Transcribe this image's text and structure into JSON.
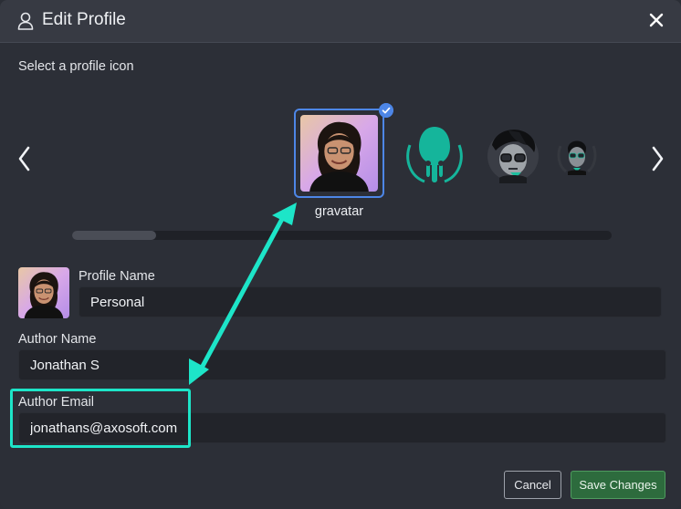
{
  "dialog": {
    "title": "Edit Profile",
    "title_icon": "user-icon",
    "close_icon": "close-icon"
  },
  "icon_picker": {
    "section_label": "Select a profile icon",
    "prev_icon": "chevron-left-icon",
    "next_icon": "chevron-right-icon",
    "selected_check_icon": "check-icon",
    "options": [
      {
        "name": "gravatar",
        "label": "gravatar",
        "selected": true
      },
      {
        "name": "gitkraken-logo",
        "selected": false
      },
      {
        "name": "keif-avatar",
        "selected": false
      },
      {
        "name": "keif-avatar-small",
        "selected": false
      }
    ],
    "scroll_position": 0.1
  },
  "form": {
    "profile_name": {
      "label": "Profile Name",
      "value": "Personal"
    },
    "author_name": {
      "label": "Author Name",
      "value": "Jonathan S"
    },
    "author_email": {
      "label": "Author Email",
      "value": "jonathans@axosoft.com"
    }
  },
  "buttons": {
    "cancel_label": "Cancel",
    "save_label": "Save Changes"
  },
  "colors": {
    "accent_selected": "#4d86e6",
    "annotation": "#1de5c8",
    "save_button": "#2d6b3d"
  }
}
